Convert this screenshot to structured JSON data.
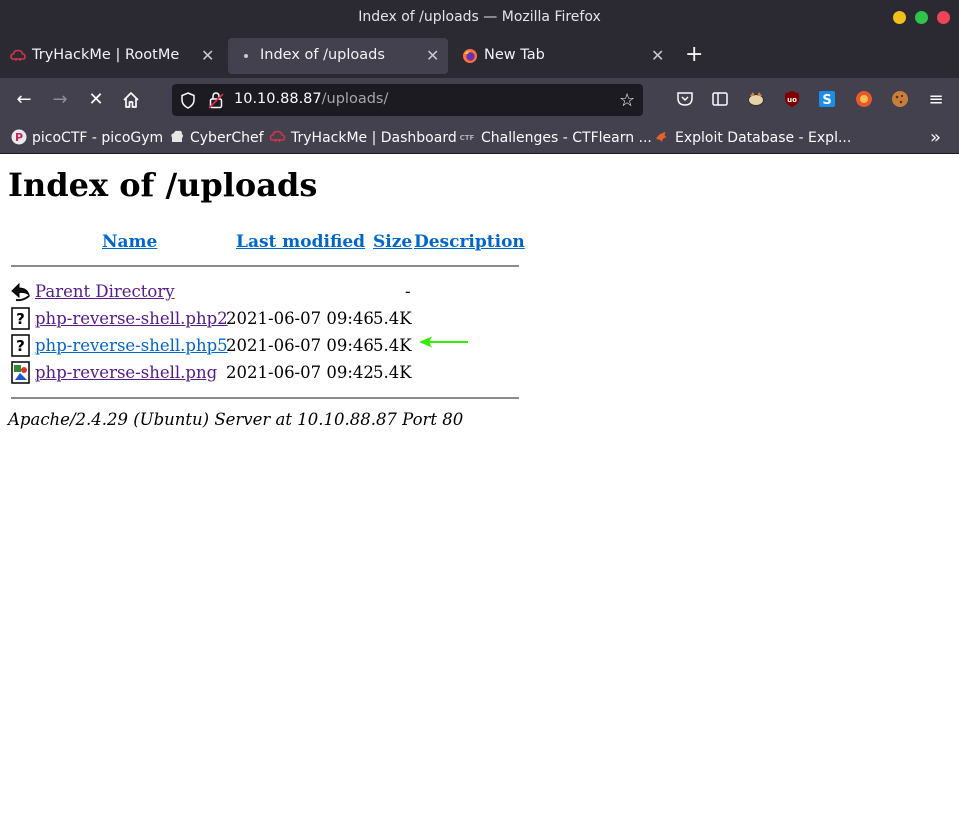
{
  "window": {
    "title": "Index of /uploads — Mozilla Firefox"
  },
  "tabs": [
    {
      "label": "TryHackMe | RootMe",
      "icon": "tryhackme-icon",
      "active": false
    },
    {
      "label": "Index of /uploads",
      "icon": "loading-dot-icon",
      "active": true
    },
    {
      "label": "New Tab",
      "icon": "firefox-icon",
      "active": false
    }
  ],
  "navbar": {
    "url_host": "10.10.88.87",
    "url_path": "/uploads/"
  },
  "bookmarks": [
    {
      "label": "picoCTF - picoGym",
      "icon": "picoctf-icon"
    },
    {
      "label": "CyberChef",
      "icon": "cyberchef-icon"
    },
    {
      "label": "TryHackMe | Dashboard",
      "icon": "tryhackme-icon"
    },
    {
      "label": "Challenges - CTFlearn ...",
      "icon": "ctf-icon"
    },
    {
      "label": "Exploit Database - Expl...",
      "icon": "exploitdb-icon"
    }
  ],
  "page": {
    "heading": "Index of /uploads",
    "columns": {
      "name": "Name",
      "last_modified": "Last modified",
      "size": "Size",
      "description": "Description"
    },
    "rows": [
      {
        "name": "Parent Directory",
        "date": "",
        "size": "-",
        "icon": "back-arrow-icon"
      },
      {
        "name": "php-reverse-shell.php2",
        "date": "2021-06-07 09:46",
        "size": "5.4K",
        "icon": "unknown-file-icon"
      },
      {
        "name": "php-reverse-shell.php5",
        "date": "2021-06-07 09:46",
        "size": "5.4K",
        "icon": "unknown-file-icon"
      },
      {
        "name": "php-reverse-shell.png",
        "date": "2021-06-07 09:42",
        "size": "5.4K",
        "icon": "image-file-icon"
      }
    ],
    "footer": "Apache/2.4.29 (Ubuntu) Server at 10.10.88.87 Port 80"
  },
  "colors": {
    "chrome_dark": "#2b2a33",
    "chrome_toolbar": "#42414d",
    "link_unvisited": "#0066cc",
    "link_visited": "#551a8b",
    "annotation_arrow": "#33ee00"
  }
}
